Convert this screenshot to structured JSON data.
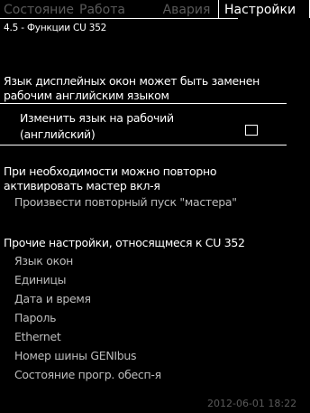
{
  "tabs": [
    {
      "label": "Состояние",
      "active": false
    },
    {
      "label": "Работа",
      "active": false
    },
    {
      "label": "Авария",
      "active": false
    },
    {
      "label": "Настройки",
      "active": true
    }
  ],
  "breadcrumb": "4.5 - Функции CU 352",
  "language_notice": {
    "line1": "Язык дисплейных окон может быть заменен",
    "line2": "рабочим английским языком"
  },
  "change_language": {
    "line1": "Изменить язык на рабочий",
    "line2": "(английский)",
    "checked": false
  },
  "wizard": {
    "line1": "При необходимости можно повторно",
    "line2": "активировать мастер вкл-я",
    "action": "Произвести повторный пуск \"мастера\""
  },
  "other_settings": {
    "heading": "Прочие настройки, относящмеся к CU 352",
    "items": [
      "Язык окон",
      "Единицы",
      "Дата и время",
      "Пароль",
      "Ethernet",
      "Номер шины GENIbus",
      "Состояние прогр. обесп-я"
    ]
  },
  "status": {
    "timestamp": "2012-06-01 18:22"
  }
}
